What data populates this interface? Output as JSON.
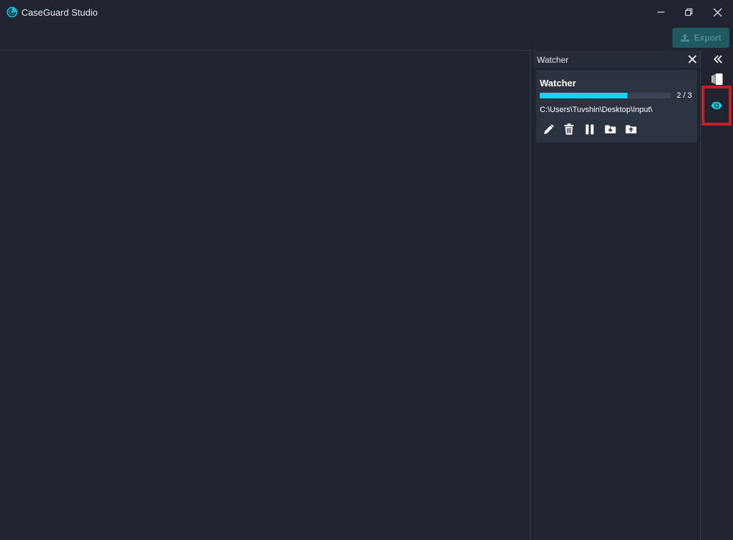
{
  "window": {
    "title": "CaseGuard Studio"
  },
  "toolbar": {
    "export_label": "Export"
  },
  "watcher_panel": {
    "title": "Watcher",
    "card": {
      "name": "Watcher",
      "progress": {
        "done": 2,
        "total": 3,
        "text": "2 / 3",
        "fraction": 0.667
      },
      "path": "C:\\Users\\Tuvshin\\Desktop\\Input\\",
      "actions": [
        "edit-icon",
        "trash-icon",
        "pause-icon",
        "folder-download-icon",
        "folder-upload-icon"
      ]
    }
  },
  "right_sidebar": {
    "items": [
      "collapse-icon",
      "panels-icon",
      "eye-icon"
    ],
    "active": "eye-icon"
  },
  "colors": {
    "accent": "#12d6ea",
    "highlight_border": "#c21f26",
    "export_bg": "#1f5a61"
  }
}
